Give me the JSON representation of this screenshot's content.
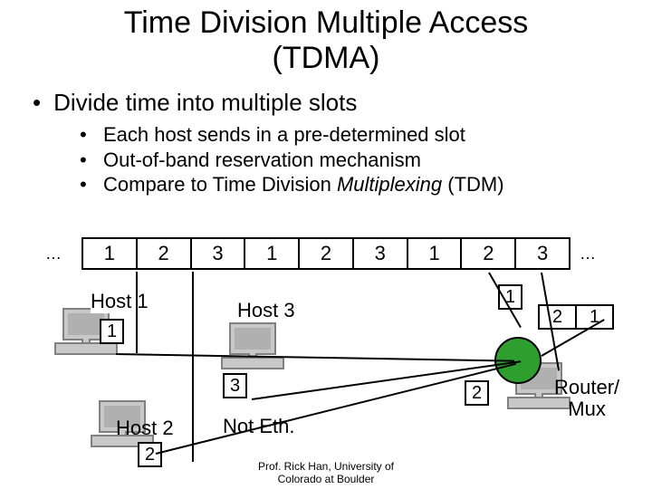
{
  "title_l1": "Time Division Multiple Access",
  "title_l2": "(TDMA)",
  "bullet_main": "Divide time into multiple slots",
  "subs": {
    "a": "Each host sends in a pre-determined slot",
    "b": "Out-of-band reservation mechanism",
    "c_pre": "Compare to Time Division ",
    "c_ital": "Multiplexing",
    "c_post": " (TDM)"
  },
  "ellipsis": "…",
  "timeline": [
    "1",
    "2",
    "3",
    "1",
    "2",
    "3",
    "1",
    "2",
    "3"
  ],
  "host1_label": "Host 1",
  "host1_num": "1",
  "host2_label": "Host 2",
  "host2_num": "2",
  "host3_label": "Host 3",
  "host3_num": "3",
  "not_eth": "Not Eth.",
  "mux_queue_top": "1",
  "mux_queue_left": "2",
  "mux_strip": [
    "2",
    "1"
  ],
  "router_l1": "Router/",
  "router_l2": "Mux",
  "footer_l1": "Prof. Rick Han, University of",
  "footer_l2": "Colorado at Boulder"
}
